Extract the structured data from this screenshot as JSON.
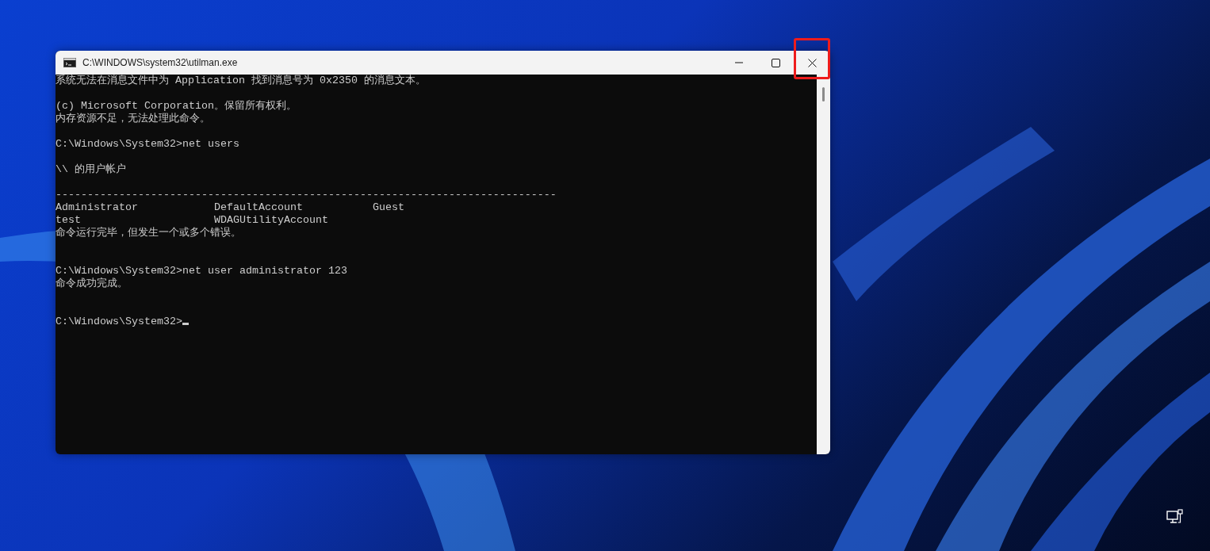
{
  "window": {
    "title": "C:\\WINDOWS\\system32\\utilman.exe",
    "close_highlighted": true
  },
  "console": [
    {
      "kind": "text",
      "text": "系统无法在消息文件中为 Application 找到消息号为 0x2350 的消息文本。"
    },
    {
      "kind": "blank"
    },
    {
      "kind": "text",
      "text": "(c) Microsoft Corporation。保留所有权利。"
    },
    {
      "kind": "text",
      "text": "内存资源不足，无法处理此命令。"
    },
    {
      "kind": "blank"
    },
    {
      "kind": "text",
      "text": "C:\\Windows\\System32>net users"
    },
    {
      "kind": "blank"
    },
    {
      "kind": "text",
      "text": "\\\\ 的用户帐户"
    },
    {
      "kind": "blank"
    },
    {
      "kind": "text",
      "text": "-------------------------------------------------------------------------------"
    },
    {
      "kind": "columns",
      "cells": [
        "Administrator",
        "DefaultAccount",
        "Guest"
      ]
    },
    {
      "kind": "columns",
      "cells": [
        "test",
        "WDAGUtilityAccount"
      ]
    },
    {
      "kind": "text",
      "text": "命令运行完毕，但发生一个或多个错误。"
    },
    {
      "kind": "blank"
    },
    {
      "kind": "blank"
    },
    {
      "kind": "text",
      "text": "C:\\Windows\\System32>net user administrator 123"
    },
    {
      "kind": "text",
      "text": "命令成功完成。"
    },
    {
      "kind": "blank"
    },
    {
      "kind": "blank"
    },
    {
      "kind": "prompt",
      "text": "C:\\Windows\\System32>"
    }
  ]
}
